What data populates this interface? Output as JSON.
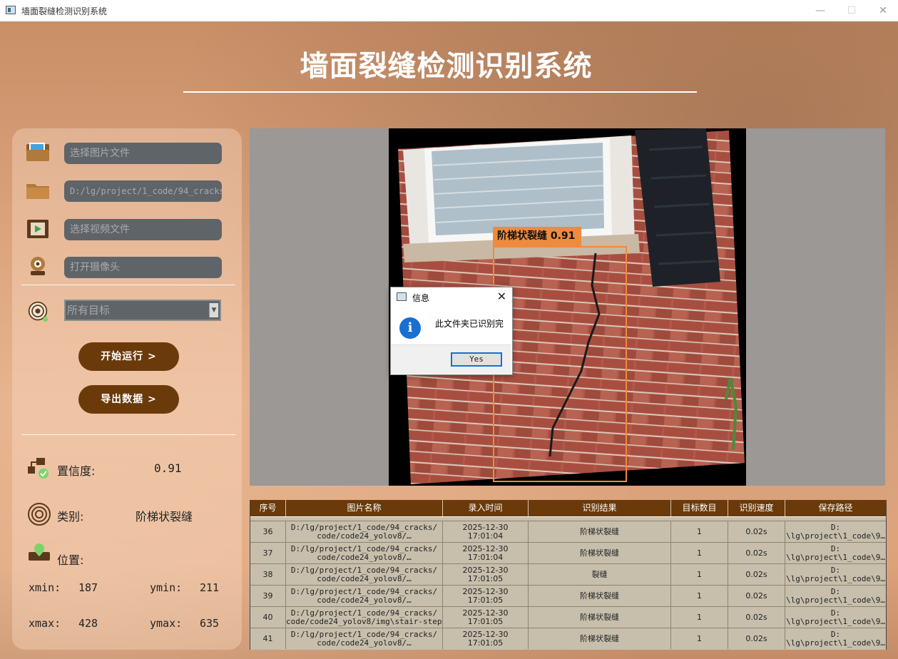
{
  "window": {
    "title": "墙面裂缝检测识别系统",
    "controls": {
      "minimize": "—",
      "maximize": "☐",
      "close": "✕"
    }
  },
  "header": {
    "title": "墙面裂缝检测识别系统"
  },
  "left_panel": {
    "inputs": {
      "image_file": "选择图片文件",
      "folder": "D:/lg/project/1_code/94_cracks",
      "video_file": "选择视频文件",
      "camera": "打开摄像头"
    },
    "target_select": {
      "value": "所有目标"
    },
    "buttons": {
      "run": "开始运行 >",
      "export": "导出数据 >"
    },
    "stats": {
      "confidence_label": "置信度:",
      "confidence_value": "0.91",
      "class_label": "类别:",
      "class_value": "阶梯状裂缝",
      "position_label": "位置:",
      "xmin_label": "xmin:",
      "xmin": "187",
      "ymin_label": "ymin:",
      "ymin": "211",
      "xmax_label": "xmax:",
      "xmax": "428",
      "ymax_label": "ymax:",
      "ymax": "635"
    }
  },
  "detection": {
    "label": "阶梯状裂缝 0.91",
    "color": "#f08a3c"
  },
  "dialog": {
    "title": "信息",
    "message": "此文件夹已识别完",
    "yes_label": "Yes",
    "icon": "info-icon"
  },
  "table": {
    "headers": [
      "序号",
      "图片名称",
      "录入时间",
      "识别结果",
      "目标数目",
      "识别速度",
      "保存路径"
    ],
    "rows": [
      {
        "id": "36",
        "name1": "D:/lg/project/1_code/94_cracks/",
        "name2": "code/code24_yolov8/…",
        "time1": "2025-12-30",
        "time2": "17:01:04",
        "result": "阶梯状裂缝",
        "count": "1",
        "speed": "0.02s",
        "path1": "D:",
        "path2": "\\lg\\project\\1_code\\9…"
      },
      {
        "id": "37",
        "name1": "D:/lg/project/1_code/94_cracks/",
        "name2": "code/code24_yolov8/…",
        "time1": "2025-12-30",
        "time2": "17:01:04",
        "result": "阶梯状裂缝",
        "count": "1",
        "speed": "0.02s",
        "path1": "D:",
        "path2": "\\lg\\project\\1_code\\9…"
      },
      {
        "id": "38",
        "name1": "D:/lg/project/1_code/94_cracks/",
        "name2": "code/code24_yolov8/…",
        "time1": "2025-12-30",
        "time2": "17:01:05",
        "result": "裂缝",
        "count": "1",
        "speed": "0.02s",
        "path1": "D:",
        "path2": "\\lg\\project\\1_code\\9…"
      },
      {
        "id": "39",
        "name1": "D:/lg/project/1_code/94_cracks/",
        "name2": "code/code24_yolov8/…",
        "time1": "2025-12-30",
        "time2": "17:01:05",
        "result": "阶梯状裂缝",
        "count": "1",
        "speed": "0.02s",
        "path1": "D:",
        "path2": "\\lg\\project\\1_code\\9…"
      },
      {
        "id": "40",
        "name1": "D:/lg/project/1_code/94_cracks/",
        "name2": "code/code24_yolov8/img\\stair-step…",
        "time1": "2025-12-30",
        "time2": "17:01:05",
        "result": "阶梯状裂缝",
        "count": "1",
        "speed": "0.02s",
        "path1": "D:",
        "path2": "\\lg\\project\\1_code\\9…"
      },
      {
        "id": "41",
        "name1": "D:/lg/project/1_code/94_cracks/",
        "name2": "code/code24_yolov8/…",
        "time1": "2025-12-30",
        "time2": "17:01:05",
        "result": "阶梯状裂缝",
        "count": "1",
        "speed": "0.02s",
        "path1": "D:",
        "path2": "\\lg\\project\\1_code\\9…"
      }
    ]
  },
  "colors": {
    "accent_brown": "#6a3a0a",
    "input_bg": "#5f6468",
    "dialog_blue": "#1a6fd0"
  }
}
